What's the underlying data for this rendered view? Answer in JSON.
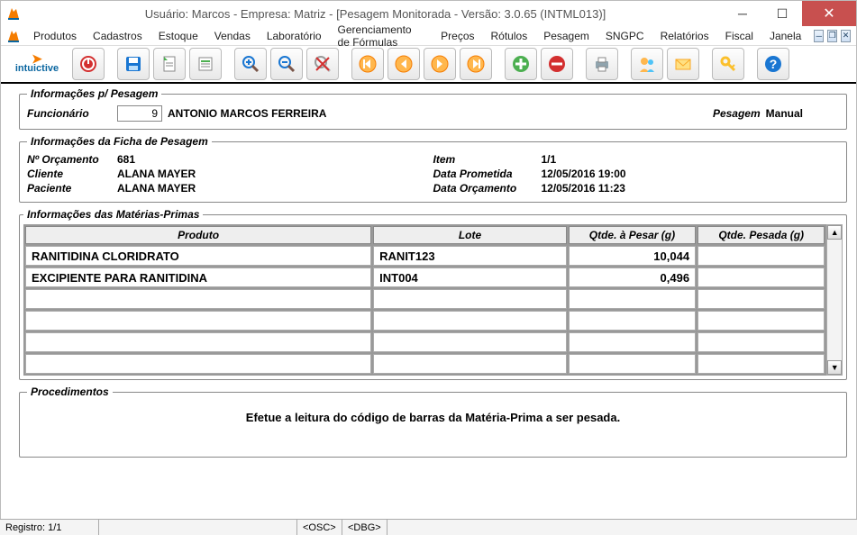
{
  "window": {
    "title": "Usuário: Marcos - Empresa: Matriz - [Pesagem Monitorada - Versão: 3.0.65 (INTML013)]"
  },
  "menu": {
    "items": [
      "Produtos",
      "Cadastros",
      "Estoque",
      "Vendas",
      "Laboratório",
      "Gerenciamento de Fórmulas",
      "Preços",
      "Rótulos",
      "Pesagem",
      "SNGPC",
      "Relatórios",
      "Fiscal",
      "Janela"
    ]
  },
  "brand": "intuictive",
  "info_pesagem": {
    "legend": "Informações p/ Pesagem",
    "funcionario_label": "Funcionário",
    "funcionario_id": "9",
    "funcionario_nome": "ANTONIO MARCOS FERREIRA",
    "pesagem_label": "Pesagem",
    "pesagem_tipo": "Manual"
  },
  "ficha": {
    "legend": "Informações da Ficha de Pesagem",
    "orcamento_label": "Nº Orçamento",
    "orcamento": "681",
    "item_label": "Item",
    "item": "1/1",
    "cliente_label": "Cliente",
    "cliente": "ALANA MAYER",
    "data_prom_label": "Data Prometida",
    "data_prom": "12/05/2016 19:00",
    "paciente_label": "Paciente",
    "paciente": "ALANA MAYER",
    "data_orc_label": "Data Orçamento",
    "data_orc": "12/05/2016 11:23"
  },
  "materias": {
    "legend": "Informações das Matérias-Primas",
    "headers": {
      "produto": "Produto",
      "lote": "Lote",
      "qtde_pesar": "Qtde. à Pesar (g)",
      "qtde_pesada": "Qtde. Pesada (g)"
    },
    "rows": [
      {
        "produto": "RANITIDINA CLORIDRATO",
        "lote": "RANIT123",
        "qtde_pesar": "10,044",
        "qtde_pesada": ""
      },
      {
        "produto": "EXCIPIENTE PARA RANITIDINA",
        "lote": "INT004",
        "qtde_pesar": "0,496",
        "qtde_pesada": ""
      },
      {
        "produto": "",
        "lote": "",
        "qtde_pesar": "",
        "qtde_pesada": ""
      },
      {
        "produto": "",
        "lote": "",
        "qtde_pesar": "",
        "qtde_pesada": ""
      },
      {
        "produto": "",
        "lote": "",
        "qtde_pesar": "",
        "qtde_pesada": ""
      },
      {
        "produto": "",
        "lote": "",
        "qtde_pesar": "",
        "qtde_pesada": ""
      }
    ]
  },
  "procedimentos": {
    "legend": "Procedimentos",
    "text": "Efetue a leitura do código de barras da Matéria-Prima a ser pesada."
  },
  "status": {
    "registro": "Registro: 1/1",
    "osc": "<OSC>",
    "dbg": "<DBG>"
  }
}
